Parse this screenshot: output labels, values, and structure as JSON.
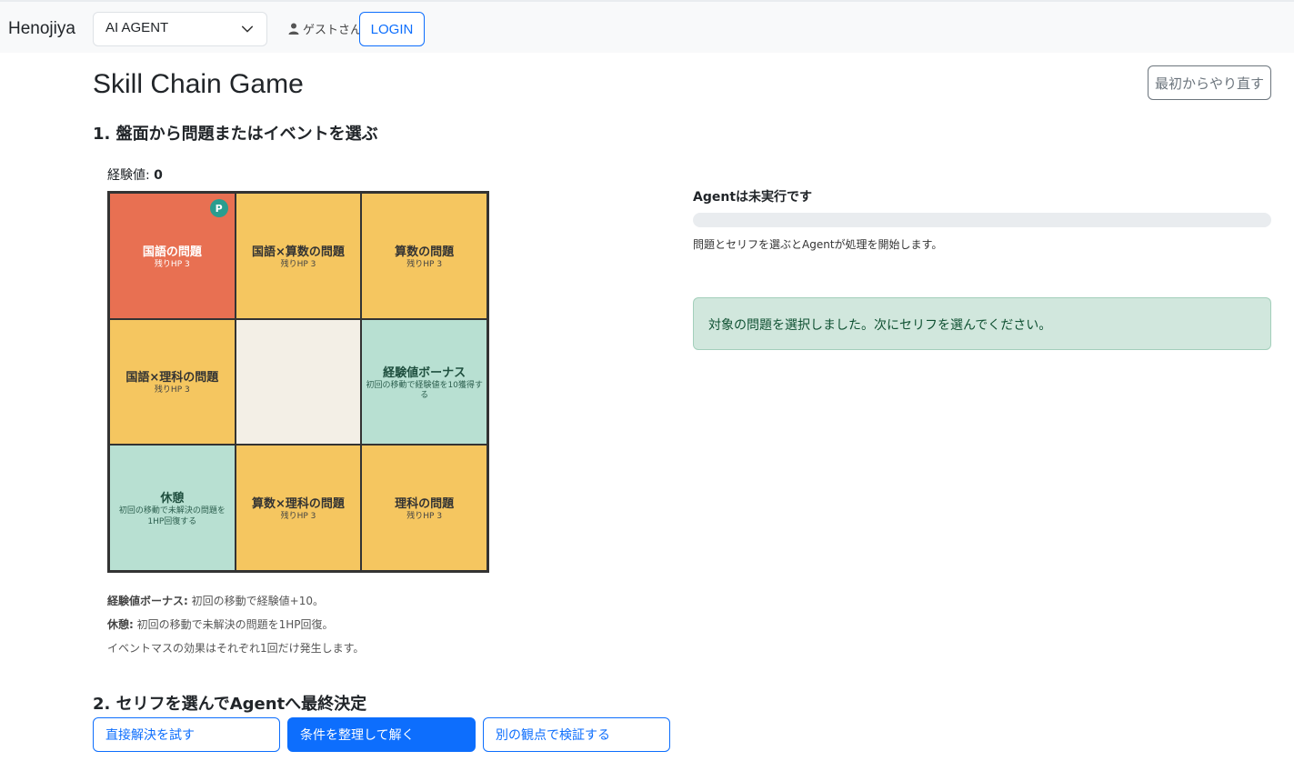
{
  "navbar": {
    "brand": "Henojiya",
    "agent_select": "AI AGENT",
    "user": "ゲストさん",
    "login": "LOGIN"
  },
  "page": {
    "title": "Skill Chain Game",
    "restart": "最初からやり直す",
    "section1": "1. 盤面から問題またはイベントを選ぶ",
    "exp_label": "経験値:",
    "exp_value": "0",
    "section2": "2. セリフを選んでAgentへ最終決定"
  },
  "board": {
    "player_badge": "P",
    "cells": [
      {
        "title": "国語の問題",
        "sub": "残りHP 3",
        "kind": "active"
      },
      {
        "title": "国語×算数の問題",
        "sub": "残りHP 3",
        "kind": "problem"
      },
      {
        "title": "算数の問題",
        "sub": "残りHP 3",
        "kind": "problem"
      },
      {
        "title": "国語×理科の問題",
        "sub": "残りHP 3",
        "kind": "problem"
      },
      {
        "title": "",
        "sub": "",
        "kind": "empty"
      },
      {
        "title": "経験値ボーナス",
        "sub": "初回の移動で経験値を10獲得する",
        "kind": "event"
      },
      {
        "title": "休憩",
        "sub": "初回の移動で未解決の問題を1HP回復する",
        "kind": "event"
      },
      {
        "title": "算数×理科の問題",
        "sub": "残りHP 3",
        "kind": "problem"
      },
      {
        "title": "理科の問題",
        "sub": "残りHP 3",
        "kind": "problem"
      }
    ]
  },
  "notes": {
    "bonus_label": "経験値ボーナス:",
    "bonus_text": "初回の移動で経験値+10。",
    "rest_label": "休憩:",
    "rest_text": "初回の移動で未解決の問題を1HP回復。",
    "event_note": "イベントマスの効果はそれぞれ1回だけ発生します。"
  },
  "serifs": [
    {
      "label": "直接解決を試す",
      "primary": false
    },
    {
      "label": "条件を整理して解く",
      "primary": true
    },
    {
      "label": "別の観点で検証する",
      "primary": false
    }
  ],
  "agent": {
    "status": "Agentは未実行です",
    "progress": 0,
    "desc": "問題とセリフを選ぶとAgentが処理を開始します。",
    "alert": "対象の問題を選択しました。次にセリフを選んでください。"
  },
  "colors": {
    "accent": "#0d6efd",
    "active_cell": "#e87052",
    "problem_cell": "#f5c660",
    "event_cell": "#b8e0d2",
    "empty_cell": "#f3efe6",
    "alert_bg": "#d1e7dd"
  }
}
